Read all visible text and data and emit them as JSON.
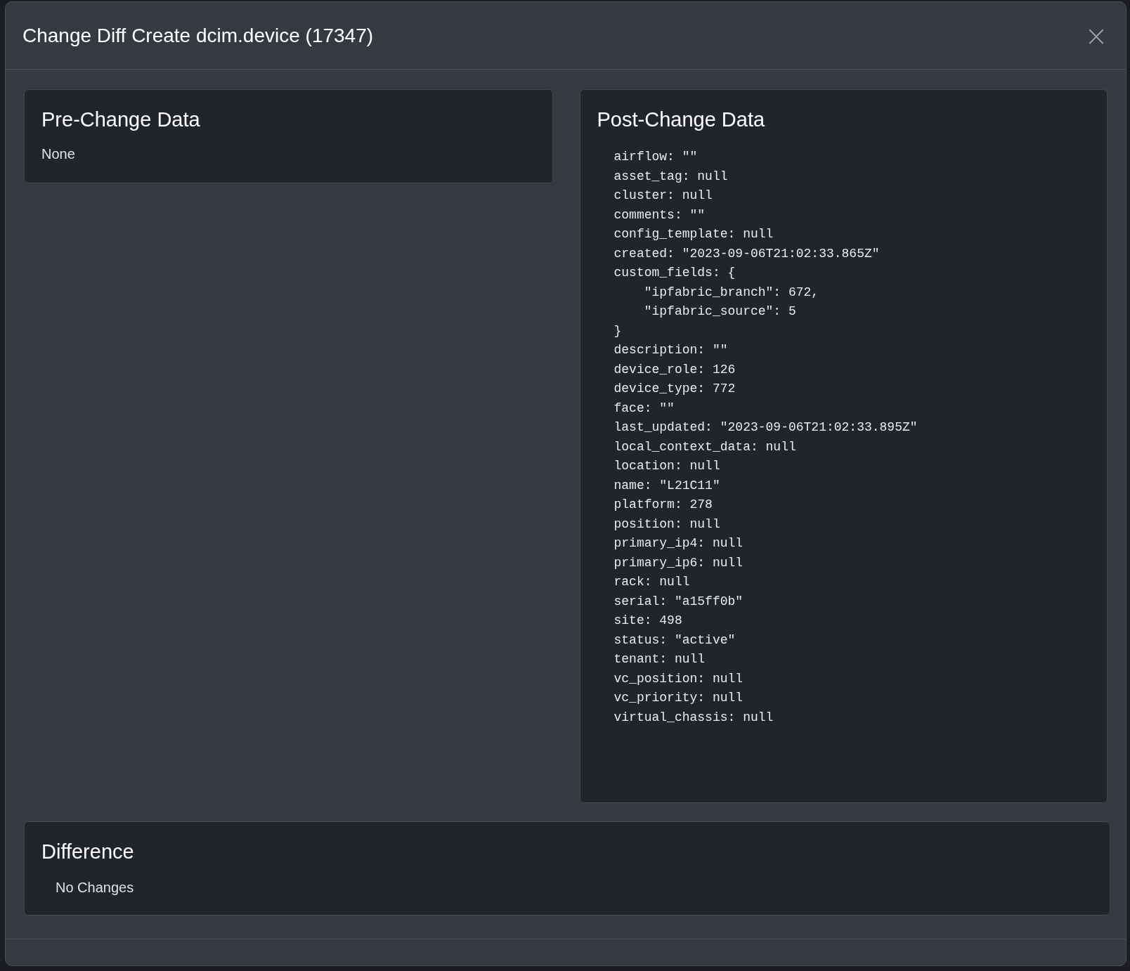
{
  "modal": {
    "title": "Change Diff Create dcim.device (17347)",
    "close_icon": "×"
  },
  "pre_change": {
    "title": "Pre-Change Data",
    "text": "None"
  },
  "post_change": {
    "title": "Post-Change Data",
    "code": "airflow: \"\"\nasset_tag: null\ncluster: null\ncomments: \"\"\nconfig_template: null\ncreated: \"2023-09-06T21:02:33.865Z\"\ncustom_fields: {\n    \"ipfabric_branch\": 672,\n    \"ipfabric_source\": 5\n}\ndescription: \"\"\ndevice_role: 126\ndevice_type: 772\nface: \"\"\nlast_updated: \"2023-09-06T21:02:33.895Z\"\nlocal_context_data: null\nlocation: null\nname: \"L21C11\"\nplatform: 278\nposition: null\nprimary_ip4: null\nprimary_ip6: null\nrack: null\nserial: \"a15ff0b\"\nsite: 498\nstatus: \"active\"\ntenant: null\nvc_position: null\nvc_priority: null\nvirtual_chassis: null"
  },
  "difference": {
    "title": "Difference",
    "text": "No Changes"
  }
}
